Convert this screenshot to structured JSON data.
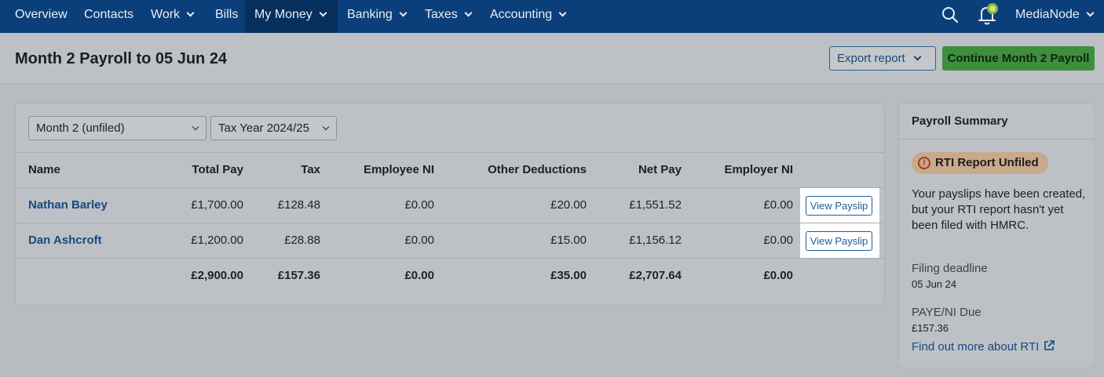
{
  "nav": {
    "items": [
      "Overview",
      "Contacts",
      "Work",
      "Bills",
      "My Money",
      "Banking",
      "Taxes",
      "Accounting"
    ],
    "active": "My Money",
    "account": "MediaNode",
    "accent": "#0b3f7a"
  },
  "header": {
    "title": "Month 2 Payroll to 05 Jun 24",
    "export_label": "Export report",
    "continue_label": "Continue Month 2 Payroll",
    "continue_color": "#3e8f3c"
  },
  "filters": {
    "period": "Month 2 (unfiled)",
    "tax_year": "Tax Year 2024/25"
  },
  "table": {
    "columns": [
      "Name",
      "Total Pay",
      "Tax",
      "Employee NI",
      "Other Deductions",
      "Net Pay",
      "Employer NI"
    ],
    "rows": [
      {
        "name": "Nathan Barley",
        "total_pay": "£1,700.00",
        "tax": "£128.48",
        "employee_ni": "£0.00",
        "other_deductions": "£20.00",
        "net_pay": "£1,551.52",
        "employer_ni": "£0.00",
        "action": "View Payslip"
      },
      {
        "name": "Dan Ashcroft",
        "total_pay": "£1,200.00",
        "tax": "£28.88",
        "employee_ni": "£0.00",
        "other_deductions": "£15.00",
        "net_pay": "£1,156.12",
        "employer_ni": "£0.00",
        "action": "View Payslip"
      }
    ],
    "totals": {
      "total_pay": "£2,900.00",
      "tax": "£157.36",
      "employee_ni": "£0.00",
      "other_deductions": "£35.00",
      "net_pay": "£2,707.64",
      "employer_ni": "£0.00"
    }
  },
  "summary": {
    "title": "Payroll Summary",
    "badge": "RTI Report Unfiled",
    "message": "Your payslips have been created, but your RTI report hasn't yet been filed with HMRC.",
    "deadline_label": "Filing deadline",
    "deadline_value": "05 Jun 24",
    "due_label": "PAYE/NI Due",
    "due_value": "£157.36",
    "link": "Find out more about RTI"
  },
  "icons": [
    "search-icon",
    "bell-icon",
    "chevron-down-icon",
    "warning-icon",
    "external-link-icon"
  ]
}
